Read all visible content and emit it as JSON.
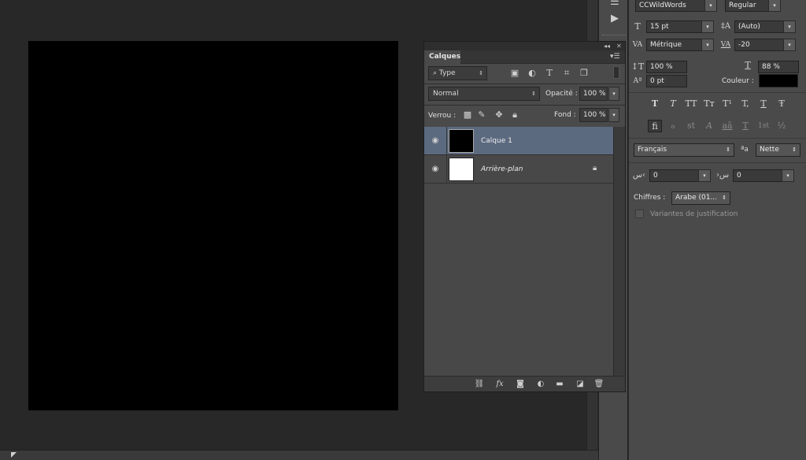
{
  "layers_panel": {
    "tab_title": "Calques",
    "filter": {
      "label": "Type"
    },
    "blend_mode": "Normal",
    "opacity": {
      "label": "Opacité :",
      "value": "100 %"
    },
    "lock": {
      "label": "Verrou :"
    },
    "fill": {
      "label": "Fond :",
      "value": "100 %"
    },
    "layers": [
      {
        "name": "Calque 1",
        "selected": true,
        "thumbnail": "#000000"
      },
      {
        "name": "Arrière-plan",
        "selected": false,
        "thumbnail": "#ffffff",
        "locked": true
      }
    ],
    "footer_icons": [
      "link-icon",
      "fx-icon",
      "mask-icon",
      "adjustment-icon",
      "folder-icon",
      "new-layer-icon",
      "trash-icon"
    ],
    "footer_fx": "fx"
  },
  "character_panel": {
    "font_family": "CCWildWords",
    "font_style": "Regular",
    "font_size": "15 pt",
    "leading": "(Auto)",
    "kerning": "Métrique",
    "tracking": "-20",
    "vertical_scale": "100 %",
    "horizontal_scale": "88 %",
    "baseline_shift": "0 pt",
    "color_label": "Couleur :",
    "color_value": "#000000",
    "type_styles": [
      "T",
      "T",
      "TT",
      "Tт",
      "T¹",
      "T,",
      "T",
      "Ŧ"
    ],
    "opentype": [
      "fi",
      "ℴ",
      "st",
      "A",
      "aā",
      "T",
      "1st",
      "½"
    ],
    "language": "Français",
    "antialias": "Nette",
    "left_value": "0",
    "right_value": "0",
    "digits_label": "Chiffres :",
    "digits_value": "Arabe (01...",
    "justification_label": "Variantes de justification"
  },
  "canvas": {
    "color": "#000000"
  },
  "colors": {
    "selection": "#5c6a80",
    "panel": "#4a4a4a",
    "workspace": "#282828"
  }
}
